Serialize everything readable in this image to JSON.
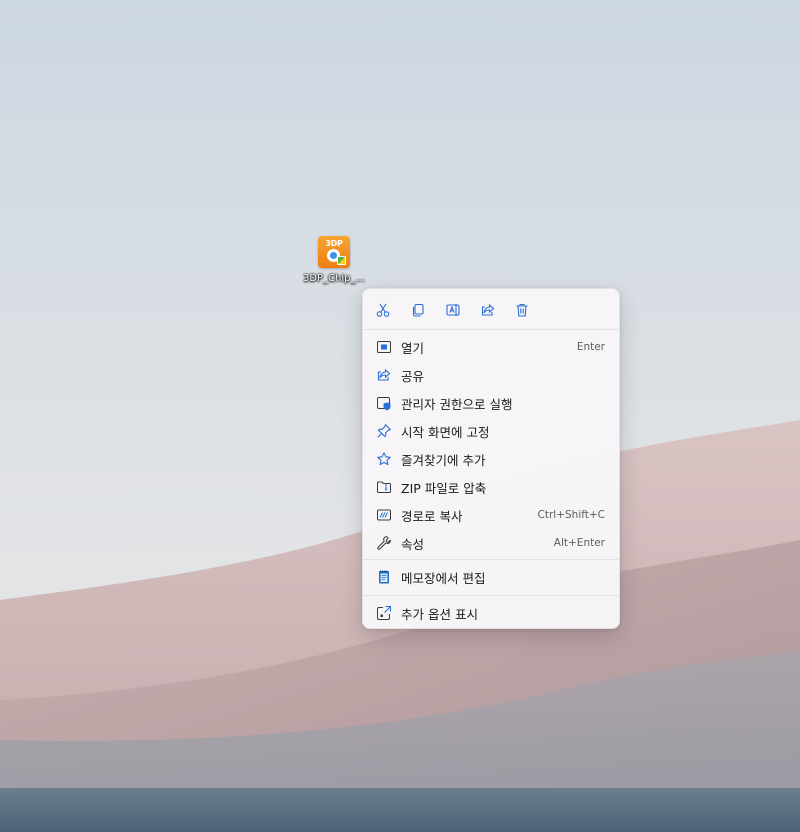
{
  "desktop": {
    "icon": {
      "label": "3DP_Chip_...",
      "logo_text": "3DP",
      "accent": "#f08a1a"
    }
  },
  "context_menu": {
    "toolbar": [
      {
        "name": "cut",
        "icon": "scissors-icon"
      },
      {
        "name": "copy",
        "icon": "copy-icon"
      },
      {
        "name": "rename",
        "icon": "rename-icon"
      },
      {
        "name": "share",
        "icon": "share-icon"
      },
      {
        "name": "delete",
        "icon": "trash-icon"
      }
    ],
    "items": [
      {
        "label": "열기",
        "shortcut": "Enter",
        "icon": "app-window-icon"
      },
      {
        "label": "공유",
        "shortcut": "",
        "icon": "share-icon"
      },
      {
        "label": "관리자 권한으로 실행",
        "shortcut": "",
        "icon": "admin-shield-icon"
      },
      {
        "label": "시작 화면에 고정",
        "shortcut": "",
        "icon": "pin-icon"
      },
      {
        "label": "즐겨찾기에 추가",
        "shortcut": "",
        "icon": "star-icon"
      },
      {
        "label": "ZIP 파일로 압축",
        "shortcut": "",
        "icon": "zip-folder-icon"
      },
      {
        "label": "경로로 복사",
        "shortcut": "Ctrl+Shift+C",
        "icon": "copy-path-icon"
      },
      {
        "label": "속성",
        "shortcut": "Alt+Enter",
        "icon": "wrench-icon"
      },
      {
        "label": "메모장에서 편집",
        "shortcut": "",
        "icon": "notepad-icon"
      },
      {
        "label": "추가 옵션 표시",
        "shortcut": "",
        "icon": "more-options-icon"
      }
    ]
  },
  "colors": {
    "icon_accent": "#2a6fd6",
    "menu_background": "#f8f6f8"
  }
}
